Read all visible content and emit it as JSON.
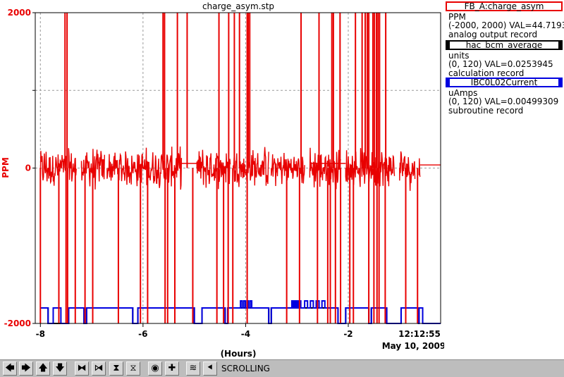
{
  "toolbar": {
    "buttons": [
      {
        "name": "scroll-left-icon",
        "glyph": "🡄"
      },
      {
        "name": "scroll-right-icon",
        "glyph": "🡆"
      },
      {
        "name": "scroll-up-icon",
        "glyph": "🡅"
      },
      {
        "name": "scroll-down-icon",
        "glyph": "🡇"
      },
      {
        "name": "zoom-in-horizontal-icon",
        "glyph": "⧓"
      },
      {
        "name": "zoom-out-horizontal-icon",
        "glyph": "⧒"
      },
      {
        "name": "zoom-in-vertical-icon",
        "glyph": "⧗"
      },
      {
        "name": "zoom-out-vertical-icon",
        "glyph": "⧖"
      },
      {
        "name": "auto-scale-icon",
        "glyph": "◉"
      },
      {
        "name": "add-trace-icon",
        "glyph": "✚"
      },
      {
        "name": "style-icon",
        "glyph": "≋"
      },
      {
        "name": "back-icon",
        "glyph": "⯇"
      }
    ],
    "mode_label": "SCROLLING"
  },
  "legend": [
    {
      "name": "FB_A:charge_asym",
      "units": "PPM",
      "range_value": "(-2000, 2000) VAL=44.7193",
      "type": "analog output record",
      "color": "#e80000"
    },
    {
      "name": "hac_bcm_average",
      "units": "units",
      "range_value": "(0, 120) VAL=0.0253945",
      "type": "calculation record",
      "color": "#000000"
    },
    {
      "name": "IBC0L02Current",
      "units": "uAmps",
      "range_value": "(0, 120) VAL=0.00499309",
      "type": "subroutine record",
      "color": "#0000e0"
    }
  ],
  "chart_data": {
    "type": "line",
    "title": "charge_asym.stp",
    "xlabel": "(Hours)",
    "ylabel": "PPM",
    "ylim": [
      -2000,
      2000
    ],
    "xlim": [
      -8.1,
      -0.2
    ],
    "x_ticks": [
      "-8",
      "-6",
      "-4",
      "-2"
    ],
    "x_tick_values": [
      -8,
      -6,
      -4,
      -2
    ],
    "y_ticks": [
      "-2000",
      "0",
      "1000",
      "2000"
    ],
    "y_tick_values": [
      -2000,
      0,
      1000,
      2000
    ],
    "y_tick_labeled": [
      true,
      true,
      false,
      true
    ],
    "time_end": "12:12:55",
    "date_end": "May 10, 2009",
    "grid": true,
    "series": [
      {
        "name": "FB_A:charge_asym",
        "color": "#e80000",
        "noise_segments": [
          [
            -8.0,
            -7.5
          ],
          [
            -7.45,
            -7.3
          ],
          [
            -7.2,
            -6.75
          ],
          [
            -6.7,
            -5.25
          ],
          [
            -4.95,
            -4.3
          ],
          [
            -4.25,
            -3.55
          ],
          [
            -3.5,
            -2.85
          ],
          [
            -2.75,
            -2.15
          ],
          [
            -2.05,
            -1.1
          ],
          [
            -1.0,
            -0.95
          ],
          [
            -0.95,
            -0.7
          ],
          [
            -0.62,
            -0.6
          ]
        ],
        "noise_amplitude": 300,
        "flat_segments": [
          [
            -5.25,
            -4.95,
            60
          ],
          [
            -2.75,
            -2.05,
            60
          ],
          [
            -0.6,
            -0.2,
            40
          ]
        ],
        "spikes_up": [
          -7.52,
          -7.48,
          -5.61,
          -5.58,
          -5.33,
          -5.14,
          -4.52,
          -4.33,
          -4.22,
          -4.12,
          -3.97,
          -3.95,
          -3.92,
          -2.92,
          -2.57,
          -2.32,
          -2.29,
          -2.16,
          -1.86,
          -1.73,
          -1.67,
          -1.63,
          -1.6,
          -1.52,
          -1.49,
          -1.45,
          -1.42,
          -1.39,
          -1.27
        ],
        "spikes_down": [
          -8.0,
          -7.64,
          -7.5,
          -7.47,
          -7.32,
          -7.13,
          -6.98,
          -6.48,
          -6.05,
          -5.91,
          -5.57,
          -5.52,
          -5.38,
          -5.03,
          -4.56,
          -4.43,
          -4.34,
          -4.25,
          -3.97,
          -3.2,
          -2.95,
          -2.6,
          -2.4,
          -2.35,
          -2.25,
          -2.15,
          -1.97,
          -1.9,
          -1.6,
          -1.5,
          -1.44,
          -1.4,
          -1.28,
          -0.88,
          -0.65
        ]
      },
      {
        "name": "hac_bcm_average",
        "color": "#000000",
        "level": -1800,
        "segments": [
          [
            -8.0,
            -7.85
          ],
          [
            -7.45,
            -7.15
          ],
          [
            -7.1,
            -6.2
          ],
          [
            -6.1,
            -5.0
          ],
          [
            -4.85,
            -4.4
          ],
          [
            -4.35,
            -3.55
          ],
          [
            -3.5,
            -2.2
          ],
          [
            -2.05,
            -1.6
          ],
          [
            -1.55,
            -1.25
          ],
          [
            -0.97,
            -0.63
          ],
          [
            -0.62,
            -0.55
          ]
        ]
      },
      {
        "name": "IBC0L02Current",
        "color": "#0000e0",
        "level": -1800,
        "baseline": -2000,
        "segments": [
          [
            -8.0,
            -7.85
          ],
          [
            -7.75,
            -7.6
          ],
          [
            -7.45,
            -7.15
          ],
          [
            -7.1,
            -6.2
          ],
          [
            -6.1,
            -5.0
          ],
          [
            -4.85,
            -4.4
          ],
          [
            -4.35,
            -3.55
          ],
          [
            -3.5,
            -2.2
          ],
          [
            -2.05,
            -1.6
          ],
          [
            -1.55,
            -1.25
          ],
          [
            -0.97,
            -0.63
          ],
          [
            -0.62,
            -0.55
          ]
        ],
        "bumps": [
          [
            -4.1,
            -3.85,
            -1710
          ],
          [
            -3.1,
            -2.9,
            -1710
          ],
          [
            -2.85,
            -2.4,
            -1710
          ],
          [
            -0.75,
            -0.6,
            -1710
          ]
        ]
      }
    ]
  }
}
